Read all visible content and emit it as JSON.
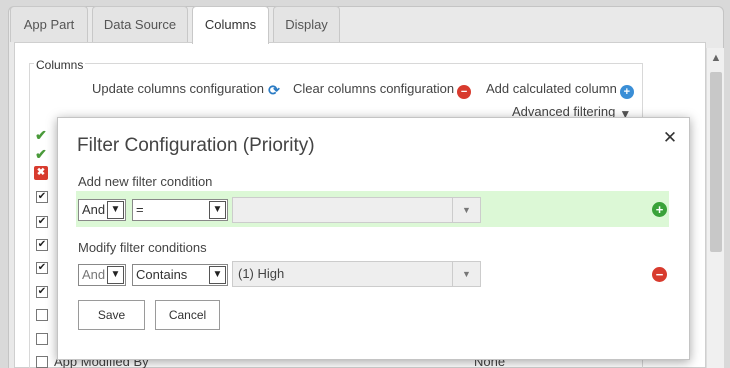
{
  "tabs": [
    {
      "label": "App Part"
    },
    {
      "label": "Data Source"
    },
    {
      "label": "Columns"
    },
    {
      "label": "Display"
    }
  ],
  "columns_section": {
    "legend": "Columns",
    "update_label": "Update columns configuration",
    "clear_label": "Clear columns configuration",
    "add_calc_label": "Add calculated column",
    "advanced_filter_label": "Advanced filtering",
    "bottom_row_label": "App Modified By",
    "bottom_row_value": "None"
  },
  "modal": {
    "title": "Filter Configuration (Priority)",
    "add_section_label": "Add new filter condition",
    "add_row": {
      "logic": "And",
      "operator": "=",
      "value": ""
    },
    "modify_section_label": "Modify filter conditions",
    "modify_row": {
      "logic": "And",
      "operator": "Contains",
      "value": "(1) High"
    },
    "save_label": "Save",
    "cancel_label": "Cancel"
  }
}
